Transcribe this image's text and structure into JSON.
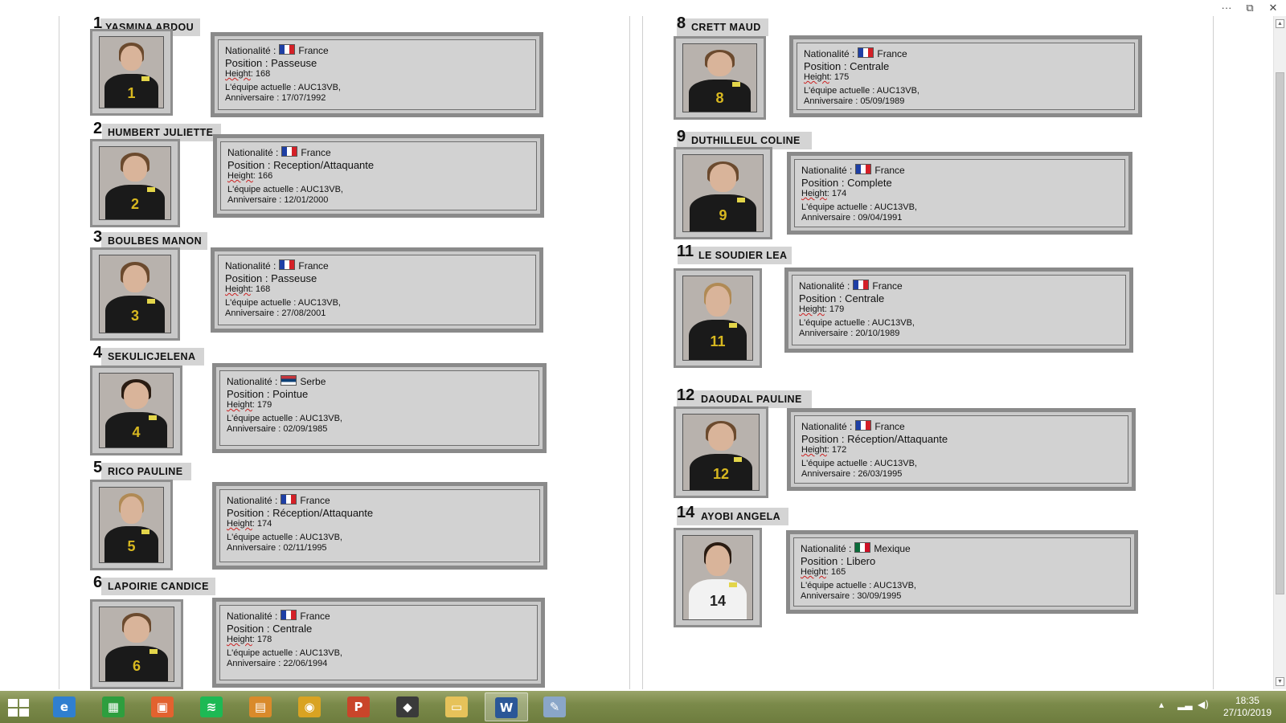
{
  "window_controls": {
    "more": "···",
    "restore": "⧉",
    "close": "✕"
  },
  "field_labels": {
    "nationality": "Nationalité :",
    "position": "Position :",
    "height": "Height",
    "team": "L'équipe actuelle :",
    "birthday": "Anniversaire :"
  },
  "players": [
    {
      "number": "1",
      "name": "YASMINA ABDOU",
      "flag": "fr",
      "nationality": "France",
      "position": "Passeuse",
      "height": "168",
      "team": "AUC13VB,",
      "birthday": "17/07/1992"
    },
    {
      "number": "2",
      "name": "HUMBERT JULIETTE",
      "flag": "fr",
      "nationality": "France",
      "position": "Reception/Attaquante",
      "height": "166",
      "team": "AUC13VB,",
      "birthday": "12/01/2000"
    },
    {
      "number": "3",
      "name": "BOULBES MANON",
      "flag": "fr",
      "nationality": "France",
      "position": "Passeuse",
      "height": "168",
      "team": "AUC13VB,",
      "birthday": "27/08/2001"
    },
    {
      "number": "4",
      "name": "SEKULICJELENA",
      "flag": "rs",
      "nationality": "Serbe",
      "position": "Pointue",
      "height": "179",
      "team": "AUC13VB,",
      "birthday": "02/09/1985"
    },
    {
      "number": "5",
      "name": "RICO PAULINE",
      "flag": "fr",
      "nationality": "France",
      "position": "Réception/Attaquante",
      "height": "174",
      "team": "AUC13VB,",
      "birthday": "02/11/1995"
    },
    {
      "number": "6",
      "name": "LAPOIRIE CANDICE",
      "flag": "fr",
      "nationality": "France",
      "position": "Centrale",
      "height": "178",
      "team": "AUC13VB,",
      "birthday": "22/06/1994"
    },
    {
      "number": "8",
      "name": "CRETT MAUD",
      "flag": "fr",
      "nationality": "France",
      "position": "Centrale",
      "height": "175",
      "team": "AUC13VB,",
      "birthday": "05/09/1989"
    },
    {
      "number": "9",
      "name": "DUTHILLEUL COLINE",
      "flag": "fr",
      "nationality": "France",
      "position": "Complete",
      "height": "174",
      "team": "AUC13VB,",
      "birthday": "09/04/1991"
    },
    {
      "number": "11",
      "name": "LE SOUDIER LEA",
      "flag": "fr",
      "nationality": "France",
      "position": "Centrale",
      "height": "179",
      "team": "AUC13VB,",
      "birthday": "20/10/1989"
    },
    {
      "number": "12",
      "name": "DAOUDAL PAULINE",
      "flag": "fr",
      "nationality": "France",
      "position": "Réception/Attaquante",
      "height": "172",
      "team": "AUC13VB,",
      "birthday": "26/03/1995"
    },
    {
      "number": "14",
      "name": "AYOBI ANGELA",
      "flag": "mx",
      "nationality": "Mexique",
      "position": "Libero",
      "height": "165",
      "team": "AUC13VB,",
      "birthday": "30/09/1995"
    }
  ],
  "taskbar": {
    "apps": [
      {
        "icon": "internet-explorer-icon",
        "color": "#2f7fd0",
        "glyph": "e"
      },
      {
        "icon": "store-icon",
        "color": "#2e9e3e",
        "glyph": "▦"
      },
      {
        "icon": "photos-icon",
        "color": "#e2622f",
        "glyph": "▣"
      },
      {
        "icon": "spotify-icon",
        "color": "#1db954",
        "glyph": "≋"
      },
      {
        "icon": "notes-icon",
        "color": "#d98a2b",
        "glyph": "▤"
      },
      {
        "icon": "chrome-icon",
        "color": "#d9a322",
        "glyph": "◉"
      },
      {
        "icon": "powerpoint-icon",
        "color": "#c9452a",
        "glyph": "P"
      },
      {
        "icon": "app-icon",
        "color": "#3a3a3a",
        "glyph": "◆"
      },
      {
        "icon": "file-explorer-icon",
        "color": "#e6c25a",
        "glyph": "▭"
      },
      {
        "icon": "word-icon",
        "color": "#2b5797",
        "glyph": "W"
      },
      {
        "icon": "paint-icon",
        "color": "#8aa6c8",
        "glyph": "✎"
      }
    ],
    "active_app": 9,
    "clock_time": "18:35",
    "clock_date": "27/10/2019"
  }
}
